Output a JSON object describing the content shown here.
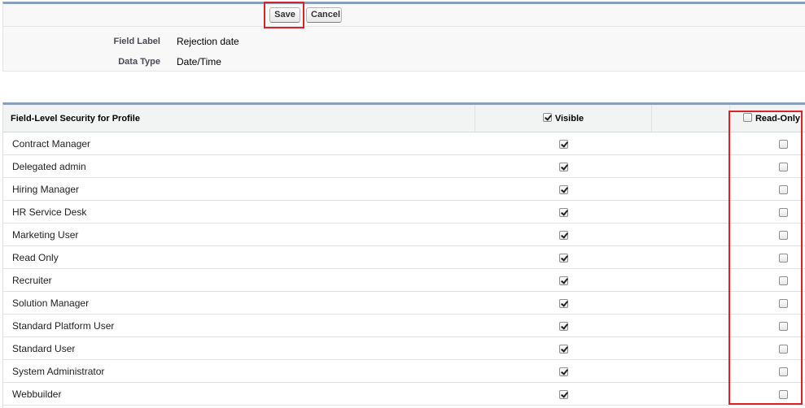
{
  "actions": {
    "save_label": "Save",
    "cancel_label": "Cancel"
  },
  "field": {
    "label_caption": "Field Label",
    "label_value": "Rejection date",
    "type_caption": "Data Type",
    "type_value": "Date/Time"
  },
  "security": {
    "header_profile": "Field-Level Security for Profile",
    "header_visible": "Visible",
    "header_visible_checked": true,
    "header_readonly": "Read-Only",
    "header_readonly_checked": false,
    "rows": [
      {
        "profile": "Contract Manager",
        "visible": true,
        "read_only": false
      },
      {
        "profile": "Delegated admin",
        "visible": true,
        "read_only": false
      },
      {
        "profile": "Hiring Manager",
        "visible": true,
        "read_only": false
      },
      {
        "profile": "HR Service Desk",
        "visible": true,
        "read_only": false
      },
      {
        "profile": "Marketing User",
        "visible": true,
        "read_only": false
      },
      {
        "profile": "Read Only",
        "visible": true,
        "read_only": false
      },
      {
        "profile": "Recruiter",
        "visible": true,
        "read_only": false
      },
      {
        "profile": "Solution Manager",
        "visible": true,
        "read_only": false
      },
      {
        "profile": "Standard Platform User",
        "visible": true,
        "read_only": false
      },
      {
        "profile": "Standard User",
        "visible": true,
        "read_only": false
      },
      {
        "profile": "System Administrator",
        "visible": true,
        "read_only": false
      },
      {
        "profile": "Webbuilder",
        "visible": true,
        "read_only": false
      }
    ]
  },
  "colors": {
    "highlight": "#d9232a",
    "panel_border": "#8a9ebe"
  }
}
